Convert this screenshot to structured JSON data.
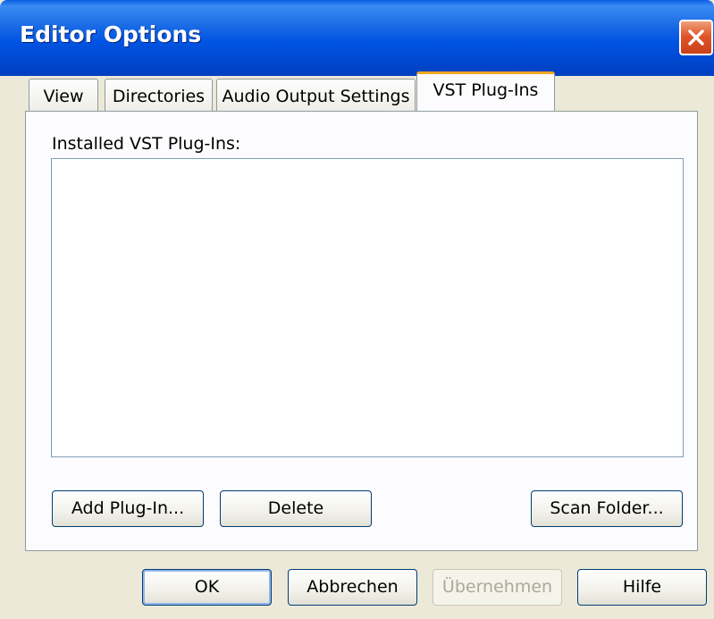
{
  "window": {
    "title": "Editor Options"
  },
  "tabs": [
    {
      "label": "View"
    },
    {
      "label": "Directories"
    },
    {
      "label": "Audio Output Settings"
    },
    {
      "label": "VST Plug-Ins"
    }
  ],
  "active_tab": "VST Plug-Ins",
  "panel": {
    "list_label": "Installed VST Plug-Ins:",
    "items": [],
    "buttons": {
      "add": "Add Plug-In...",
      "delete": "Delete",
      "scan": "Scan Folder..."
    }
  },
  "footer": {
    "ok": "OK",
    "cancel": "Abbrechen",
    "apply": "Übernehmen",
    "help": "Hilfe"
  },
  "icons": {
    "close": "close-icon"
  },
  "colors": {
    "titlebar": "#0054e3",
    "close": "#e0562a",
    "active_tab_accent": "#f5a623",
    "face": "#ece9d8"
  }
}
